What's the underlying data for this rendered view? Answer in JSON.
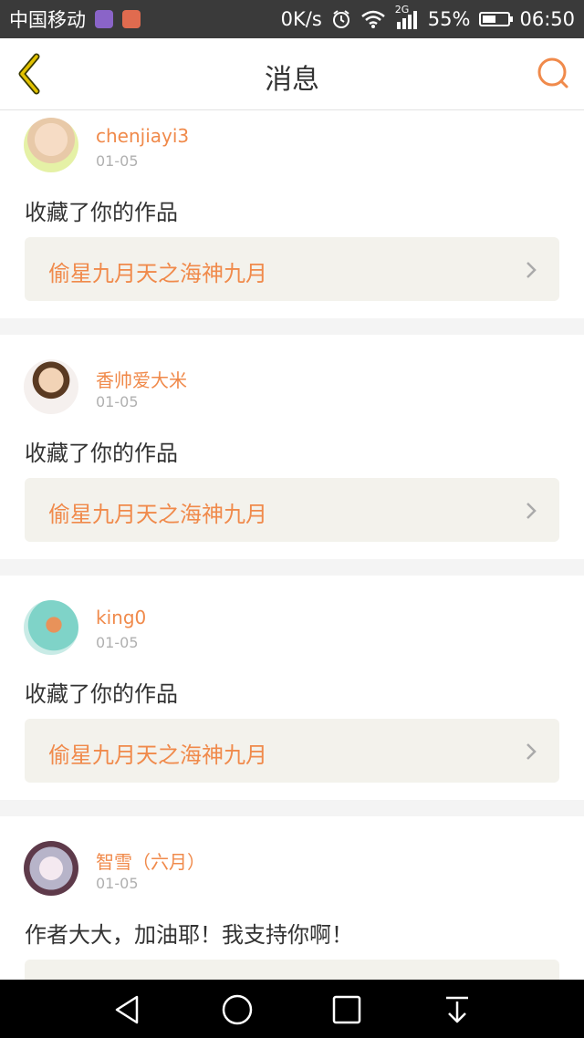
{
  "status_bar": {
    "carrier": "中国移动",
    "speed": "0K/s",
    "network": "2G",
    "battery": "55%",
    "battery_level": 0.55,
    "time": "06:50"
  },
  "header": {
    "title": "消息"
  },
  "messages": [
    {
      "username": "chenjiayi3",
      "date": "01-05",
      "text": "收藏了你的作品",
      "work_title": "偷星九月天之海神九月"
    },
    {
      "username": "香帅爱大米",
      "date": "01-05",
      "text": "收藏了你的作品",
      "work_title": "偷星九月天之海神九月"
    },
    {
      "username": "king0",
      "date": "01-05",
      "text": "收藏了你的作品",
      "work_title": "偷星九月天之海神九月"
    },
    {
      "username": "智雪（六月）",
      "date": "01-05",
      "text": "作者大大，加油耶！我支持你啊！",
      "work_title": ""
    }
  ],
  "colors": {
    "accent": "#f08a4b",
    "link_bg": "#f3f2ec",
    "back_icon": "#d4b400"
  },
  "icons": {
    "back": "back-chevron-icon",
    "search": "search-icon",
    "link_arrow": "chevron-right-icon",
    "nav": [
      "nav-back-icon",
      "nav-home-icon",
      "nav-recents-icon",
      "nav-notification-pulldown-icon"
    ]
  }
}
